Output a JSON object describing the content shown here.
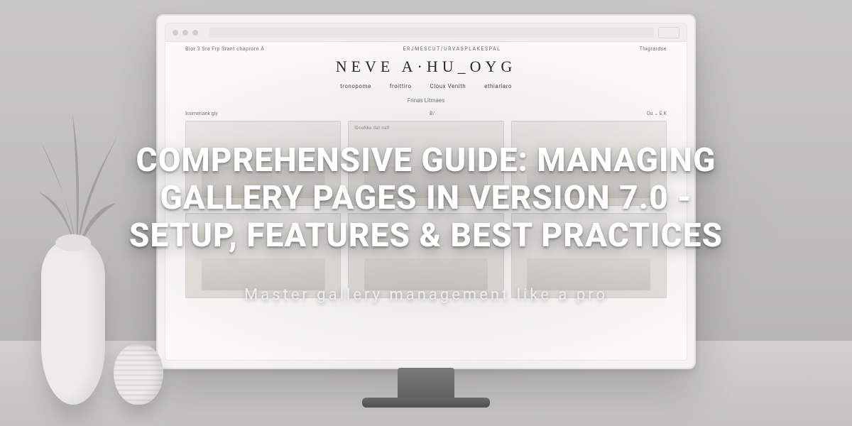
{
  "hero": {
    "headline": "Comprehensive Guide: Managing Gallery Pages in Version 7.0 - Setup, Features & Best Practices",
    "subtitle": "Master gallery management like a pro"
  },
  "screen": {
    "toprow_left": "Bior 3 Sra Frp Srant   chaprorn A",
    "toprow_center": "ERJMESCUT/URVASPLAKESPAL",
    "toprow_right": "Thigrardse",
    "brand": "NEVE A·HU_OYG",
    "nav": [
      "tronopome",
      "froittiro",
      "Cloux Venith",
      "ethiariaro"
    ],
    "subnav": "Frinas Litmaes",
    "filter_left": "Iroimeriank giy",
    "filter_mid": "B/",
    "filter_right": "Ou ⌄ E  K",
    "tiles": [
      {
        "label": ""
      },
      {
        "label": "lDnohke dat nall"
      },
      {
        "label": ""
      },
      {
        "label": ""
      },
      {
        "label": ""
      },
      {
        "label": ""
      }
    ]
  }
}
